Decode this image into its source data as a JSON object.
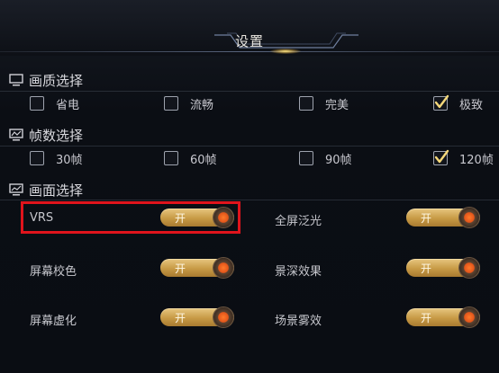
{
  "title": "设置",
  "sections": {
    "quality": {
      "title": "画质选择",
      "options": [
        {
          "label": "省电",
          "checked": false
        },
        {
          "label": "流畅",
          "checked": false
        },
        {
          "label": "完美",
          "checked": false
        },
        {
          "label": "极致",
          "checked": true
        }
      ]
    },
    "fps": {
      "title": "帧数选择",
      "options": [
        {
          "label": "30帧",
          "checked": false
        },
        {
          "label": "60帧",
          "checked": false
        },
        {
          "label": "90帧",
          "checked": false
        },
        {
          "label": "120帧",
          "checked": true
        }
      ]
    },
    "display": {
      "title": "画面选择",
      "rows": [
        {
          "left": {
            "label": "VRS",
            "state": "开"
          },
          "right": {
            "label": "全屏泛光",
            "state": "开"
          }
        },
        {
          "left": {
            "label": "屏幕校色",
            "state": "开"
          },
          "right": {
            "label": "景深效果",
            "state": "开"
          }
        },
        {
          "left": {
            "label": "屏幕虚化",
            "state": "开"
          },
          "right": {
            "label": "场景雾效",
            "state": "开"
          }
        }
      ]
    }
  },
  "colors": {
    "accent_gold": "#c79a45",
    "knob_orange": "#e2551a",
    "highlight_red": "#e0141c"
  }
}
